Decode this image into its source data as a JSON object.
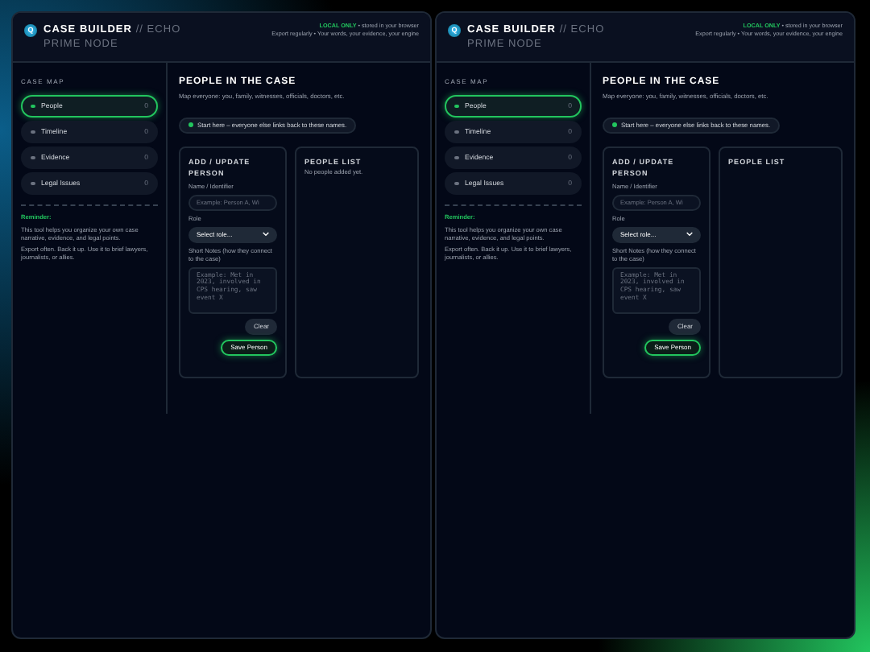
{
  "panels": [
    {
      "header": {
        "logo_letter": "Q",
        "title": "CASE BUILDER",
        "subtitle": "// ECHO PRIME NODE",
        "notice_label": "LOCAL ONLY",
        "notice_text": "• stored in your browser",
        "notice_line2": "Export regularly • Your words, your evidence, your engine"
      },
      "sidebar": {
        "heading": "CASE MAP",
        "items": [
          {
            "label": "People",
            "count": "0",
            "selected": true
          },
          {
            "label": "Timeline",
            "count": "0",
            "selected": false
          },
          {
            "label": "Evidence",
            "count": "0",
            "selected": false
          },
          {
            "label": "Legal Issues",
            "count": "0",
            "selected": false
          }
        ],
        "reminder_title": "Reminder:",
        "reminder_paragraphs": [
          "This tool helps you organize your own case narrative, evidence, and legal points.",
          "Export often. Back it up. Use it to brief lawyers, journalists, or allies."
        ]
      },
      "main": {
        "title": "PEOPLE IN THE CASE",
        "subtitle": "Map everyone: you, family, witnesses, officials, doctors, etc.",
        "hint": "Start here – everyone else links back to these names.",
        "form": {
          "title": "ADD / UPDATE PERSON",
          "fields": [
            {
              "kind": "input",
              "label": "Name / Identifier",
              "placeholder": "Example: Person A, Wi"
            },
            {
              "kind": "select",
              "label": "Role",
              "value": "Select role..."
            },
            {
              "kind": "textarea",
              "label": "Short Notes (how they connect to the case)",
              "placeholder": "Example: Met in 2023, involved in CPS hearing, saw event X"
            }
          ],
          "buttons": [
            {
              "label": "Clear",
              "kind": "secondary"
            },
            {
              "label": "Save Person",
              "kind": "primary"
            }
          ]
        },
        "list": {
          "title": "PEOPLE LIST",
          "empty_message": "No people added yet."
        }
      }
    },
    {
      "header": {
        "logo_letter": "Q",
        "title": "CASE BUILDER",
        "subtitle": "// ECHO PRIME NODE",
        "notice_label": "LOCAL ONLY",
        "notice_text": "• stored in your browser",
        "notice_line2": "Export regularly • Your words, your evidence, your engine"
      },
      "sidebar": {
        "heading": "CASE MAP",
        "items": [
          {
            "label": "People",
            "count": "0",
            "selected": true
          },
          {
            "label": "Timeline",
            "count": "0",
            "selected": false
          },
          {
            "label": "Evidence",
            "count": "0",
            "selected": false
          },
          {
            "label": "Legal Issues",
            "count": "0",
            "selected": false
          }
        ],
        "reminder_title": "Reminder:",
        "reminder_paragraphs": [
          "This tool helps you organize your own case narrative, evidence, and legal points.",
          "Export often. Back it up. Use it to brief lawyers, journalists, or allies."
        ]
      },
      "main": {
        "title": "PEOPLE IN THE CASE",
        "subtitle": "Map everyone: you, family, witnesses, officials, doctors, etc.",
        "hint": "Start here – everyone else links back to these names.",
        "form": {
          "title": "ADD / UPDATE PERSON",
          "fields": [
            {
              "kind": "input",
              "label": "Name / Identifier",
              "placeholder": "Example: Person A, Wi"
            },
            {
              "kind": "select",
              "label": "Role",
              "value": "Select role..."
            },
            {
              "kind": "textarea",
              "label": "Short Notes (how they connect to the case)",
              "placeholder": "Example: Met in 2023, involved in CPS hearing, saw event X"
            }
          ],
          "buttons": [
            {
              "label": "Clear",
              "kind": "secondary"
            },
            {
              "label": "Save Person",
              "kind": "primary"
            }
          ]
        },
        "list": {
          "title": "PEOPLE LIST"
        }
      }
    }
  ]
}
